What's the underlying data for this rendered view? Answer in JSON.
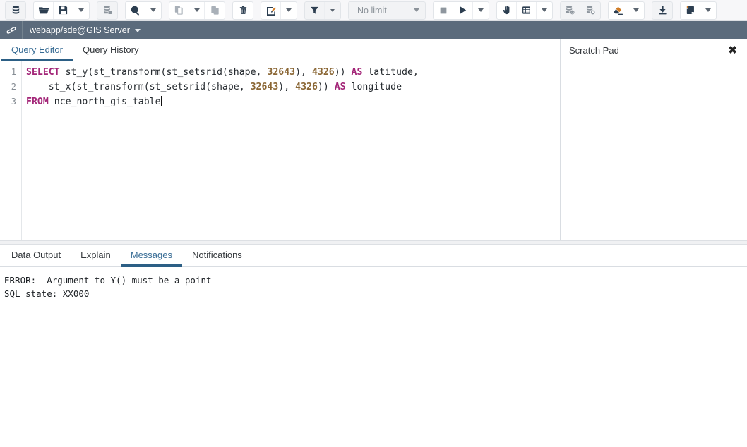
{
  "toolbar": {
    "groups": [
      {
        "name": "object-explorer-group",
        "buttons": [
          {
            "name": "stacked-disks-icon",
            "label": "Object Explorer"
          }
        ]
      },
      {
        "name": "file-group",
        "buttons": [
          {
            "name": "open-folder-icon",
            "label": "Open File"
          },
          {
            "name": "save-icon",
            "label": "Save"
          },
          {
            "name": "save-options-caret-icon",
            "label": "Save options"
          }
        ]
      },
      {
        "name": "query-tool-group",
        "buttons": [
          {
            "name": "database-query-icon",
            "label": "Query Tool"
          }
        ]
      },
      {
        "name": "find-group",
        "buttons": [
          {
            "name": "search-icon",
            "label": "Find"
          },
          {
            "name": "find-options-caret-icon",
            "label": "Find options"
          }
        ]
      },
      {
        "name": "clipboard-group",
        "buttons": [
          {
            "name": "copy-icon",
            "label": "Copy"
          },
          {
            "name": "copy-options-caret-icon",
            "label": "Copy options"
          },
          {
            "name": "paste-icon",
            "label": "Paste"
          }
        ]
      },
      {
        "name": "delete-group",
        "buttons": [
          {
            "name": "trash-icon",
            "label": "Delete"
          }
        ]
      },
      {
        "name": "edit-group",
        "buttons": [
          {
            "name": "edit-pencil-icon",
            "label": "Edit"
          },
          {
            "name": "edit-options-caret-icon",
            "label": "Edit options"
          }
        ]
      },
      {
        "name": "filter-group",
        "buttons": [
          {
            "name": "filter-funnel-icon",
            "label": "Filter"
          },
          {
            "name": "filter-options-caret-icon",
            "label": "Filter options"
          }
        ]
      },
      {
        "name": "execute-group",
        "buttons": [
          {
            "name": "stop-icon",
            "label": "Stop"
          },
          {
            "name": "execute-play-icon",
            "label": "Execute/Refresh"
          },
          {
            "name": "execute-options-caret-icon",
            "label": "Execute options"
          }
        ]
      },
      {
        "name": "explain-group",
        "buttons": [
          {
            "name": "explain-hand-icon",
            "label": "Explain"
          },
          {
            "name": "explain-analyze-icon",
            "label": "Explain Analyze"
          },
          {
            "name": "explain-options-caret-icon",
            "label": "Explain options"
          }
        ]
      },
      {
        "name": "transaction-group",
        "buttons": [
          {
            "name": "commit-icon",
            "label": "Commit"
          },
          {
            "name": "rollback-icon",
            "label": "Rollback"
          }
        ]
      },
      {
        "name": "clear-group",
        "buttons": [
          {
            "name": "eraser-icon",
            "label": "Clear"
          },
          {
            "name": "clear-options-caret-icon",
            "label": "Clear options"
          }
        ]
      },
      {
        "name": "download-group",
        "buttons": [
          {
            "name": "download-icon",
            "label": "Download as CSV"
          }
        ]
      },
      {
        "name": "macro-group",
        "buttons": [
          {
            "name": "macro-icon",
            "label": "Macros"
          },
          {
            "name": "macro-options-caret-icon",
            "label": "Macro options"
          }
        ]
      }
    ],
    "row_limit": {
      "value": "No limit"
    }
  },
  "connection": {
    "icon": "link-icon",
    "label": "webapp/sde@GIS Server"
  },
  "editor": {
    "tabs": [
      {
        "label": "Query Editor",
        "active": true
      },
      {
        "label": "Query History",
        "active": false
      }
    ],
    "line_numbers": [
      "1",
      "2",
      "3"
    ],
    "sql_lines": [
      [
        {
          "t": "kw",
          "v": "SELECT"
        },
        {
          "t": "p",
          "v": " st_y(st_transform(st_setsrid(shape, "
        },
        {
          "t": "num",
          "v": "32643"
        },
        {
          "t": "p",
          "v": "), "
        },
        {
          "t": "num",
          "v": "4326"
        },
        {
          "t": "p",
          "v": ")) "
        },
        {
          "t": "kw",
          "v": "AS"
        },
        {
          "t": "p",
          "v": " latitude,"
        }
      ],
      [
        {
          "t": "p",
          "v": "    st_x(st_transform(st_setsrid(shape, "
        },
        {
          "t": "num",
          "v": "32643"
        },
        {
          "t": "p",
          "v": "), "
        },
        {
          "t": "num",
          "v": "4326"
        },
        {
          "t": "p",
          "v": ")) "
        },
        {
          "t": "kw",
          "v": "AS"
        },
        {
          "t": "p",
          "v": " longitude"
        }
      ],
      [
        {
          "t": "kw",
          "v": "FROM"
        },
        {
          "t": "p",
          "v": " nce_north_gis_table"
        },
        {
          "t": "cursor",
          "v": ""
        }
      ]
    ]
  },
  "scratch_pad": {
    "title": "Scratch Pad",
    "close_label": "✖",
    "content": ""
  },
  "output_panel": {
    "tabs": [
      {
        "label": "Data Output",
        "active": false
      },
      {
        "label": "Explain",
        "active": false
      },
      {
        "label": "Messages",
        "active": true
      },
      {
        "label": "Notifications",
        "active": false
      }
    ],
    "messages": "ERROR:  Argument to Y() must be a point\nSQL state: XX000"
  },
  "colors": {
    "connection_bar": "#5b6b7c",
    "active_tab": "#2c5f85",
    "keyword": "#a32678",
    "number": "#8a6634"
  }
}
